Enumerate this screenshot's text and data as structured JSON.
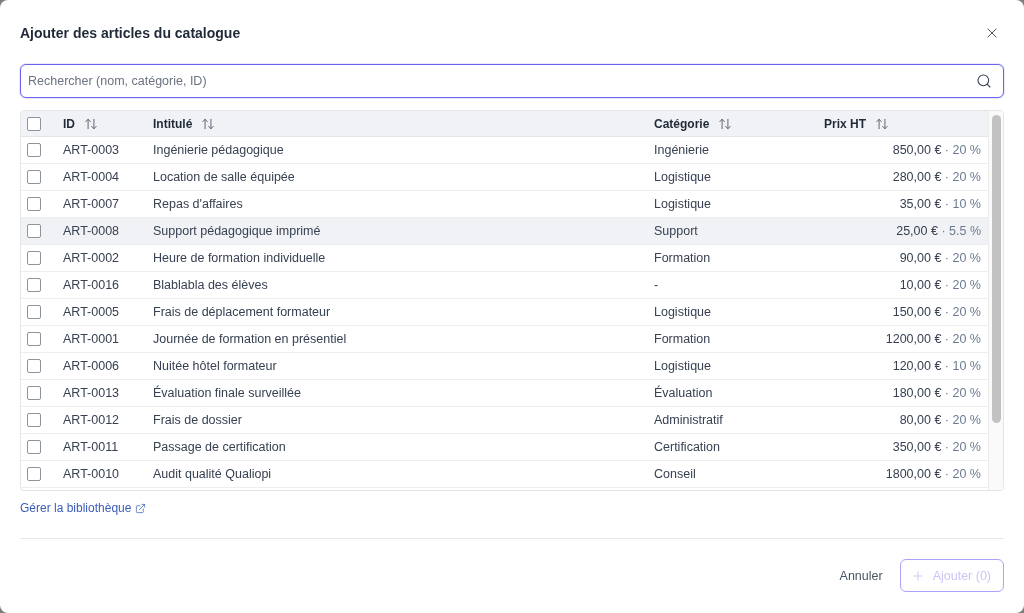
{
  "dialog": {
    "title": "Ajouter des articles du catalogue"
  },
  "search": {
    "placeholder": "Rechercher (nom, catégorie, ID)",
    "focused": true
  },
  "table": {
    "select_all": {
      "checked": false
    },
    "columns": [
      {
        "label": "ID"
      },
      {
        "label": "Intitulé"
      },
      {
        "label": "Catégorie"
      },
      {
        "label": "Prix HT"
      }
    ],
    "rows": [
      {
        "checked": false,
        "hovered": false,
        "id": "ART-0003",
        "title": "Ingénierie pédagogique",
        "category": "Ingénierie",
        "price": "850,00 €",
        "vat": "· 20 %"
      },
      {
        "checked": false,
        "hovered": false,
        "id": "ART-0004",
        "title": "Location de salle équipée",
        "category": "Logistique",
        "price": "280,00 €",
        "vat": "· 20 %"
      },
      {
        "checked": false,
        "hovered": false,
        "id": "ART-0007",
        "title": "Repas d'affaires",
        "category": "Logistique",
        "price": "35,00 €",
        "vat": "· 10 %"
      },
      {
        "checked": false,
        "hovered": true,
        "id": "ART-0008",
        "title": "Support pédagogique imprimé",
        "category": "Support",
        "price": "25,00 €",
        "vat": "· 5.5 %"
      },
      {
        "checked": false,
        "hovered": false,
        "id": "ART-0002",
        "title": "Heure de formation individuelle",
        "category": "Formation",
        "price": "90,00 €",
        "vat": "· 20 %"
      },
      {
        "checked": false,
        "hovered": false,
        "id": "ART-0016",
        "title": "Blablabla des élèves",
        "category": "-",
        "price": "10,00 €",
        "vat": "· 20 %"
      },
      {
        "checked": false,
        "hovered": false,
        "id": "ART-0005",
        "title": "Frais de déplacement formateur",
        "category": "Logistique",
        "price": "150,00 €",
        "vat": "· 20 %"
      },
      {
        "checked": false,
        "hovered": false,
        "id": "ART-0001",
        "title": "Journée de formation en présentiel",
        "category": "Formation",
        "price": "1200,00 €",
        "vat": "· 20 %"
      },
      {
        "checked": false,
        "hovered": false,
        "id": "ART-0006",
        "title": "Nuitée hôtel formateur",
        "category": "Logistique",
        "price": "120,00 €",
        "vat": "· 10 %"
      },
      {
        "checked": false,
        "hovered": false,
        "id": "ART-0013",
        "title": "Évaluation finale surveillée",
        "category": "Évaluation",
        "price": "180,00 €",
        "vat": "· 20 %"
      },
      {
        "checked": false,
        "hovered": false,
        "id": "ART-0012",
        "title": "Frais de dossier",
        "category": "Administratif",
        "price": "80,00 €",
        "vat": "· 20 %"
      },
      {
        "checked": false,
        "hovered": false,
        "id": "ART-0011",
        "title": "Passage de certification",
        "category": "Certification",
        "price": "350,00 €",
        "vat": "· 20 %"
      },
      {
        "checked": false,
        "hovered": false,
        "id": "ART-0010",
        "title": "Audit qualité Qualiopi",
        "category": "Conseil",
        "price": "1800,00 €",
        "vat": "· 20 %"
      }
    ]
  },
  "library_link": "Gérer la bibliothèque",
  "footer": {
    "cancel": "Annuler",
    "add": {
      "label": "Ajouter (0)",
      "disabled": true
    }
  }
}
